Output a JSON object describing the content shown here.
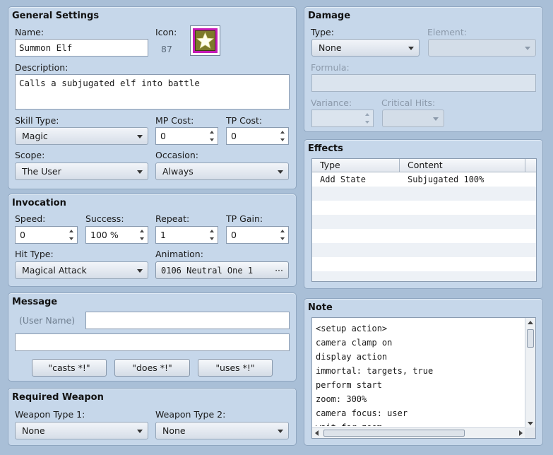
{
  "general": {
    "title": "General Settings",
    "name_label": "Name:",
    "name_value": "Summon Elf",
    "icon_label": "Icon:",
    "icon_index": "87",
    "icon_color": "#c51bb7",
    "description_label": "Description:",
    "description_value": "Calls a subjugated elf into battle",
    "skill_type_label": "Skill Type:",
    "skill_type_value": "Magic",
    "mp_cost_label": "MP Cost:",
    "mp_cost_value": "0",
    "tp_cost_label": "TP Cost:",
    "tp_cost_value": "0",
    "scope_label": "Scope:",
    "scope_value": "The User",
    "occasion_label": "Occasion:",
    "occasion_value": "Always"
  },
  "invocation": {
    "title": "Invocation",
    "speed_label": "Speed:",
    "speed_value": "0",
    "success_label": "Success:",
    "success_value": "100 %",
    "repeat_label": "Repeat:",
    "repeat_value": "1",
    "tp_gain_label": "TP Gain:",
    "tp_gain_value": "0",
    "hit_type_label": "Hit Type:",
    "hit_type_value": "Magical Attack",
    "animation_label": "Animation:",
    "animation_value": "0106 Neutral One 1",
    "animation_button": "···"
  },
  "message": {
    "title": "Message",
    "user_name_placeholder": "(User Name)",
    "line1_value": "",
    "line2_value": "",
    "buttons": [
      "\"casts *!\"",
      "\"does *!\"",
      "\"uses *!\""
    ]
  },
  "required_weapon": {
    "title": "Required Weapon",
    "type1_label": "Weapon Type 1:",
    "type1_value": "None",
    "type2_label": "Weapon Type 2:",
    "type2_value": "None"
  },
  "damage": {
    "title": "Damage",
    "type_label": "Type:",
    "type_value": "None",
    "element_label": "Element:",
    "element_value": "",
    "formula_label": "Formula:",
    "formula_value": "",
    "variance_label": "Variance:",
    "variance_value": "",
    "critical_label": "Critical Hits:",
    "critical_value": ""
  },
  "effects": {
    "title": "Effects",
    "columns": [
      "Type",
      "Content"
    ],
    "rows": [
      {
        "type": "Add State",
        "content": "Subjugated 100%"
      }
    ]
  },
  "note": {
    "title": "Note",
    "lines": [
      "<setup action>",
      "camera clamp on",
      "display action",
      "immortal: targets, true",
      "perform start",
      "zoom: 300%",
      "camera focus: user",
      "wait for zoom"
    ]
  }
}
